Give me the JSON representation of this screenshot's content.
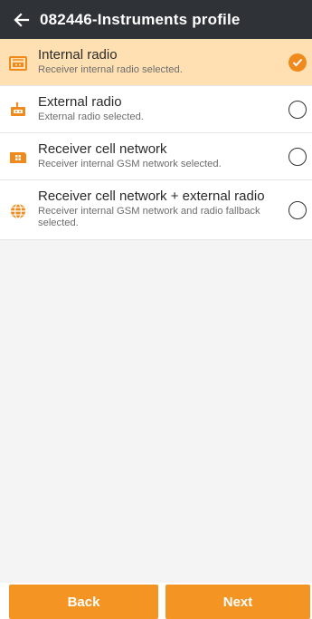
{
  "header": {
    "title": "082446-Instruments profile"
  },
  "options": [
    {
      "label": "Internal radio",
      "description": "Receiver internal radio selected.",
      "icon": "internal-radio-icon",
      "selected": true
    },
    {
      "label": "External radio",
      "description": "External radio selected.",
      "icon": "external-radio-icon",
      "selected": false
    },
    {
      "label": "Receiver cell network",
      "description": "Receiver internal GSM network selected.",
      "icon": "sim-card-icon",
      "selected": false
    },
    {
      "label": "Receiver cell network + external radio",
      "description": "Receiver internal GSM network and radio fallback selected.",
      "icon": "globe-icon",
      "selected": false
    }
  ],
  "footer": {
    "back_label": "Back",
    "next_label": "Next"
  },
  "colors": {
    "accent": "#f39423",
    "selected_row": "#ffe0b2",
    "header_bg": "#2f3237"
  }
}
